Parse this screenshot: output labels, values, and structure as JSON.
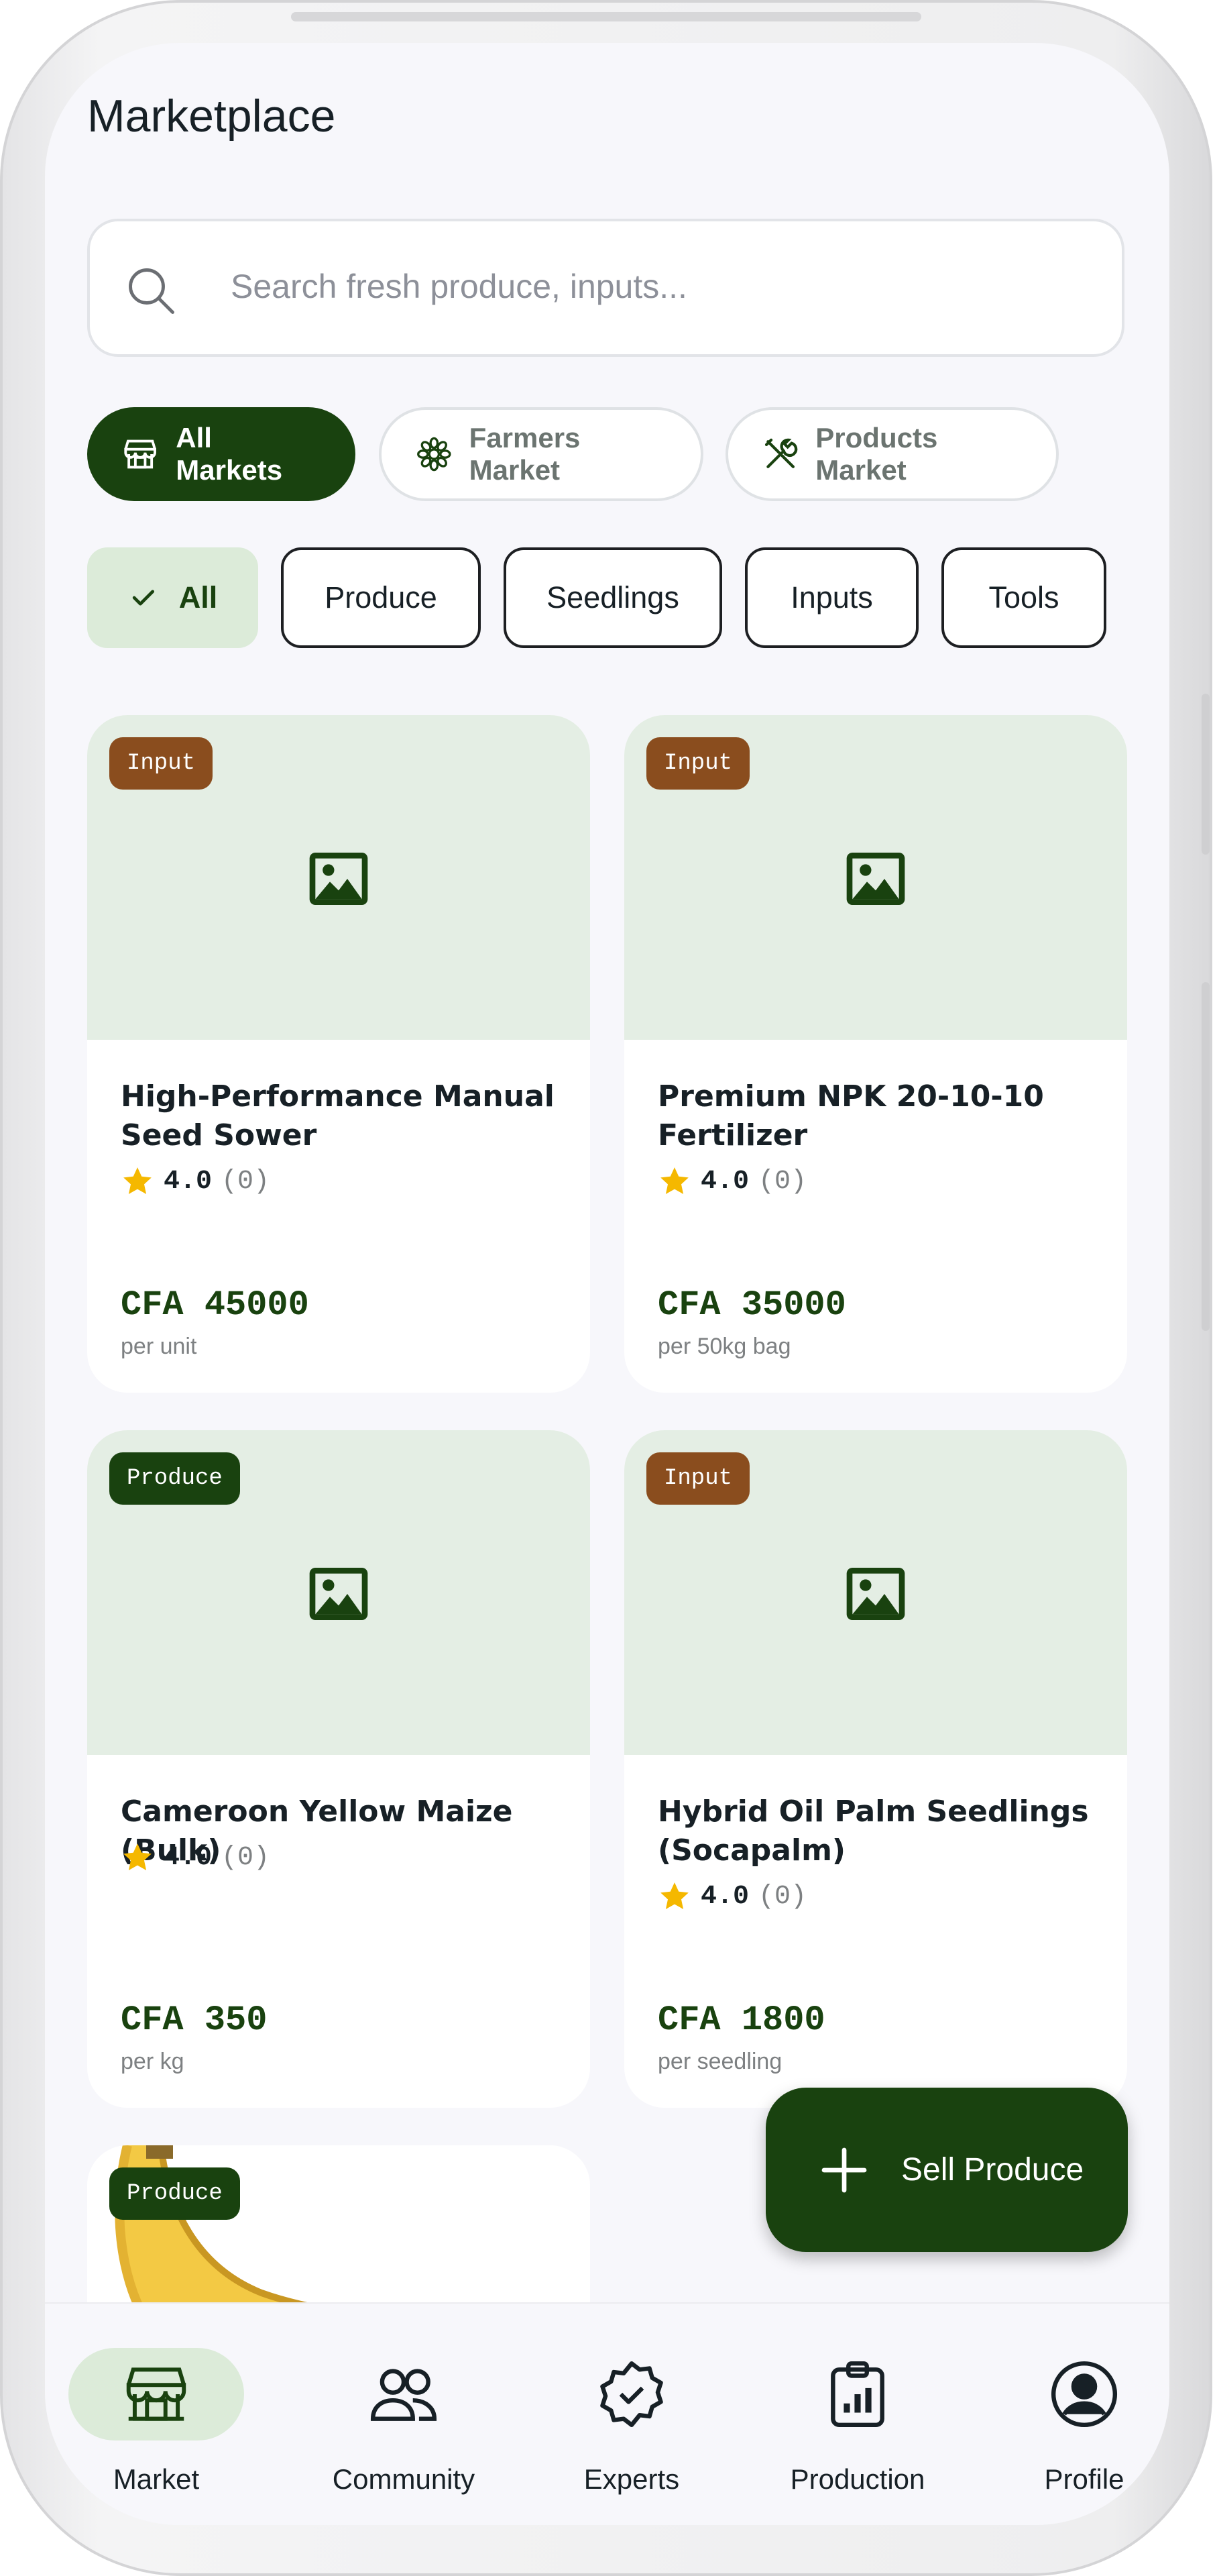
{
  "header": {
    "title": "Marketplace"
  },
  "search": {
    "placeholder": "Search fresh produce, inputs..."
  },
  "markets": [
    {
      "label": "All Markets",
      "active": true,
      "icon": "store-icon"
    },
    {
      "label": "Farmers Market",
      "active": false,
      "icon": "flower-icon"
    },
    {
      "label": "Products Market",
      "active": false,
      "icon": "tools-icon"
    }
  ],
  "categories": [
    {
      "label": "All",
      "active": true
    },
    {
      "label": "Produce",
      "active": false
    },
    {
      "label": "Seedlings",
      "active": false
    },
    {
      "label": "Inputs",
      "active": false
    },
    {
      "label": "Tools",
      "active": false
    }
  ],
  "products": [
    {
      "badge": "Input",
      "name": "High-Performance Manual Seed Sower",
      "rating": "4.0",
      "reviews": "(0)",
      "price": "CFA 45000",
      "unit": "per unit"
    },
    {
      "badge": "Input",
      "name": "Premium NPK 20-10-10 Fertilizer",
      "rating": "4.0",
      "reviews": "(0)",
      "price": "CFA 35000",
      "unit": "per 50kg bag"
    },
    {
      "badge": "Produce",
      "name": "Cameroon Yellow Maize (Bulk)",
      "rating": "4.0",
      "reviews": "(0)",
      "price": "CFA 350",
      "unit": "per kg"
    },
    {
      "badge": "Input",
      "name": "Hybrid Oil Palm Seedlings (Socapalm)",
      "rating": "4.0",
      "reviews": "(0)",
      "price": "CFA 1800",
      "unit": "per seedling"
    },
    {
      "badge": "Produce"
    }
  ],
  "fab": {
    "label": "Sell Produce"
  },
  "nav": [
    {
      "label": "Market",
      "active": true
    },
    {
      "label": "Community",
      "active": false
    },
    {
      "label": "Experts",
      "active": false
    },
    {
      "label": "Production",
      "active": false
    },
    {
      "label": "Profile",
      "active": false
    }
  ],
  "colors": {
    "primary": "#19420f",
    "input_badge": "#8a4d1e",
    "image_bg": "#e4eee4",
    "chip_active_bg": "#dcebd9",
    "star": "#f5b800"
  }
}
